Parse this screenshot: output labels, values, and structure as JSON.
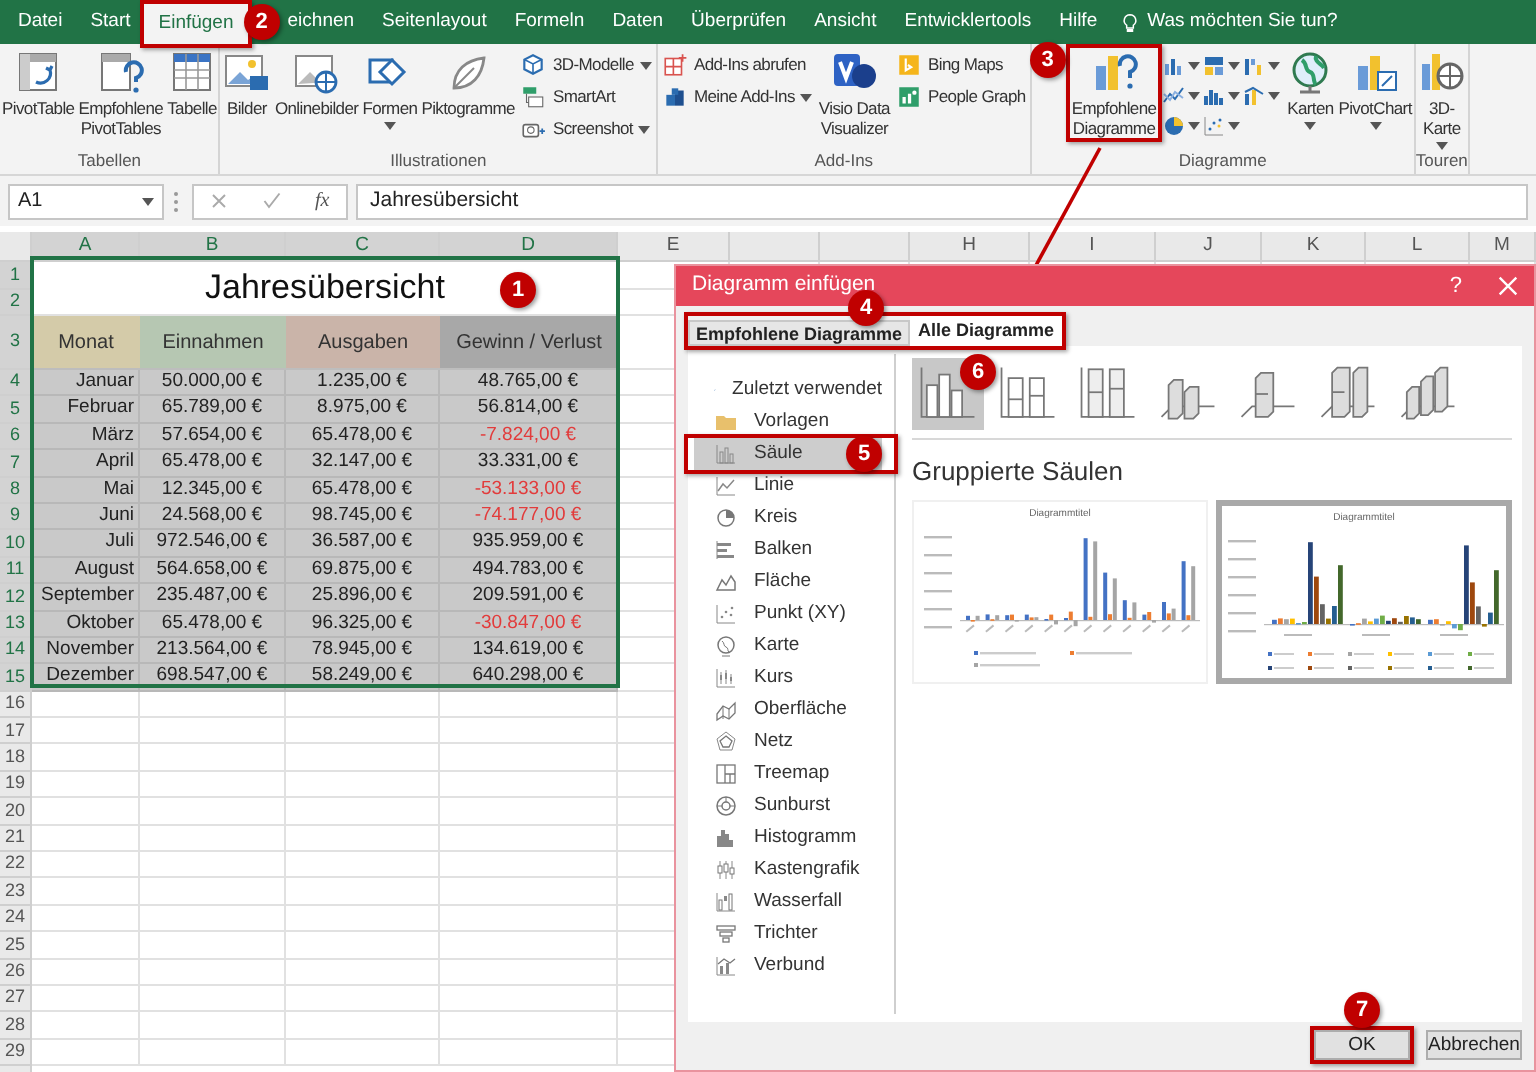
{
  "ribbon_tabs": [
    {
      "label": "Datei",
      "selected": false
    },
    {
      "label": "Start",
      "selected": false
    },
    {
      "label": "Einfügen",
      "selected": true
    },
    {
      "label": "eichnen",
      "selected": false
    },
    {
      "label": "Seitenlayout",
      "selected": false
    },
    {
      "label": "Formeln",
      "selected": false
    },
    {
      "label": "Daten",
      "selected": false
    },
    {
      "label": "Überprüfen",
      "selected": false
    },
    {
      "label": "Ansicht",
      "selected": false
    },
    {
      "label": "Entwicklertools",
      "selected": false
    },
    {
      "label": "Hilfe",
      "selected": false
    }
  ],
  "tell_me": "Was möchten Sie tun?",
  "ribbon_groups": [
    {
      "label": "Tabellen",
      "controls": [
        {
          "kind": "large",
          "label": "PivotTable"
        },
        {
          "kind": "large",
          "label": "Empfohlene\nPivotTables"
        },
        {
          "kind": "large",
          "label": "Tabelle"
        }
      ]
    },
    {
      "label": "Illustrationen",
      "controls": [
        {
          "kind": "large",
          "label": "Bilder"
        },
        {
          "kind": "large",
          "label": "Onlinebilder"
        },
        {
          "kind": "large",
          "label": "Formen",
          "dropdown": true
        },
        {
          "kind": "large",
          "label": "Piktogramme"
        },
        {
          "kind": "stack",
          "items": [
            {
              "label": "3D-Modelle",
              "dropdown": true
            },
            {
              "label": "SmartArt"
            },
            {
              "label": "Screenshot",
              "dropdown": true
            }
          ]
        }
      ]
    },
    {
      "label": "Add-Ins",
      "controls": [
        {
          "kind": "stack",
          "items": [
            {
              "label": "Add-Ins abrufen"
            },
            {
              "label": "Meine Add-Ins",
              "dropdown": true
            }
          ]
        },
        {
          "kind": "large",
          "label": "Visio Data\nVisualizer"
        },
        {
          "kind": "stack",
          "items": [
            {
              "label": "Bing Maps"
            },
            {
              "label": "People Graph"
            }
          ]
        }
      ]
    },
    {
      "label": "Diagramme",
      "controls": [
        {
          "kind": "large",
          "label": "Empfohlene\nDiagramme"
        },
        {
          "kind": "chart_grid"
        },
        {
          "kind": "large",
          "label": "Karten",
          "dropdown": true
        },
        {
          "kind": "large",
          "label": "PivotChart",
          "dropdown": true
        }
      ]
    },
    {
      "label": "Touren",
      "controls": [
        {
          "kind": "large",
          "label": "3D-\nKarte",
          "dropdown": true
        }
      ]
    }
  ],
  "formula_bar": {
    "name_box": "A1",
    "function_label": "fx",
    "formula": "Jahresübersicht"
  },
  "sheet": {
    "column_headers": [
      "A",
      "B",
      "C",
      "D",
      "E",
      "H",
      "I",
      "J",
      "K",
      "L",
      "M"
    ],
    "row_numbers": [
      "1",
      "2",
      "3",
      "4",
      "5",
      "6",
      "7",
      "8",
      "9",
      "10",
      "11",
      "12",
      "13",
      "14",
      "15",
      "16",
      "17",
      "18",
      "19",
      "20",
      "21",
      "22",
      "23",
      "24",
      "25",
      "26",
      "27",
      "28",
      "29"
    ],
    "title": "Jahresübersicht",
    "columns": [
      {
        "label": "Monat",
        "color": "#d4cba9"
      },
      {
        "label": "Einnahmen",
        "color": "#b6c7b2"
      },
      {
        "label": "Ausgaben",
        "color": "#cab4a9"
      },
      {
        "label": "Gewinn / Verlust",
        "color": "#a8a8a8"
      }
    ],
    "rows": [
      {
        "month": "Januar",
        "income": "50.000,00 €",
        "expenses": "1.235,00 €",
        "result": "48.765,00 €",
        "negative": false
      },
      {
        "month": "Februar",
        "income": "65.789,00 €",
        "expenses": "8.975,00 €",
        "result": "56.814,00 €",
        "negative": false
      },
      {
        "month": "März",
        "income": "57.654,00 €",
        "expenses": "65.478,00 €",
        "result": "-7.824,00 €",
        "negative": true
      },
      {
        "month": "April",
        "income": "65.478,00 €",
        "expenses": "32.147,00 €",
        "result": "33.331,00 €",
        "negative": false
      },
      {
        "month": "Mai",
        "income": "12.345,00 €",
        "expenses": "65.478,00 €",
        "result": "-53.133,00 €",
        "negative": true
      },
      {
        "month": "Juni",
        "income": "24.568,00 €",
        "expenses": "98.745,00 €",
        "result": "-74.177,00 €",
        "negative": true
      },
      {
        "month": "Juli",
        "income": "972.546,00 €",
        "expenses": "36.587,00 €",
        "result": "935.959,00 €",
        "negative": false
      },
      {
        "month": "August",
        "income": "564.658,00 €",
        "expenses": "69.875,00 €",
        "result": "494.783,00 €",
        "negative": false
      },
      {
        "month": "September",
        "income": "235.487,00 €",
        "expenses": "25.896,00 €",
        "result": "209.591,00 €",
        "negative": false
      },
      {
        "month": "Oktober",
        "income": "65.478,00 €",
        "expenses": "96.325,00 €",
        "result": "-30.847,00 €",
        "negative": true
      },
      {
        "month": "November",
        "income": "213.564,00 €",
        "expenses": "78.945,00 €",
        "result": "134.619,00 €",
        "negative": false
      },
      {
        "month": "Dezember",
        "income": "698.547,00 €",
        "expenses": "58.249,00 €",
        "result": "640.298,00 €",
        "negative": false
      }
    ]
  },
  "dialog": {
    "title": "Diagramm einfügen",
    "help": "?",
    "tabs": [
      {
        "label": "Empfohlene Diagramme",
        "selected": false
      },
      {
        "label": "Alle Diagramme",
        "selected": true
      }
    ],
    "chart_types": [
      {
        "label": "Zuletzt verwendet",
        "selected": false
      },
      {
        "label": "Vorlagen",
        "selected": false
      },
      {
        "label": "Säule",
        "selected": true
      },
      {
        "label": "Linie",
        "selected": false
      },
      {
        "label": "Kreis",
        "selected": false
      },
      {
        "label": "Balken",
        "selected": false
      },
      {
        "label": "Fläche",
        "selected": false
      },
      {
        "label": "Punkt (XY)",
        "selected": false
      },
      {
        "label": "Karte",
        "selected": false
      },
      {
        "label": "Kurs",
        "selected": false
      },
      {
        "label": "Oberfläche",
        "selected": false
      },
      {
        "label": "Netz",
        "selected": false
      },
      {
        "label": "Treemap",
        "selected": false
      },
      {
        "label": "Sunburst",
        "selected": false
      },
      {
        "label": "Histogramm",
        "selected": false
      },
      {
        "label": "Kastengrafik",
        "selected": false
      },
      {
        "label": "Wasserfall",
        "selected": false
      },
      {
        "label": "Trichter",
        "selected": false
      },
      {
        "label": "Verbund",
        "selected": false
      }
    ],
    "subtypes": [
      {
        "selected": true
      },
      {
        "selected": false
      },
      {
        "selected": false
      },
      {
        "selected": false
      },
      {
        "selected": false
      },
      {
        "selected": false
      },
      {
        "selected": false
      }
    ],
    "subtype_title": "Gruppierte Säulen",
    "previews": [
      {
        "title": "Diagrammtitel",
        "selected": false
      },
      {
        "title": "Diagrammtitel",
        "selected": true
      }
    ],
    "buttons": [
      "OK",
      "Abbrechen"
    ]
  },
  "annotations": [
    "1",
    "2",
    "3",
    "4",
    "5",
    "6",
    "7"
  ]
}
